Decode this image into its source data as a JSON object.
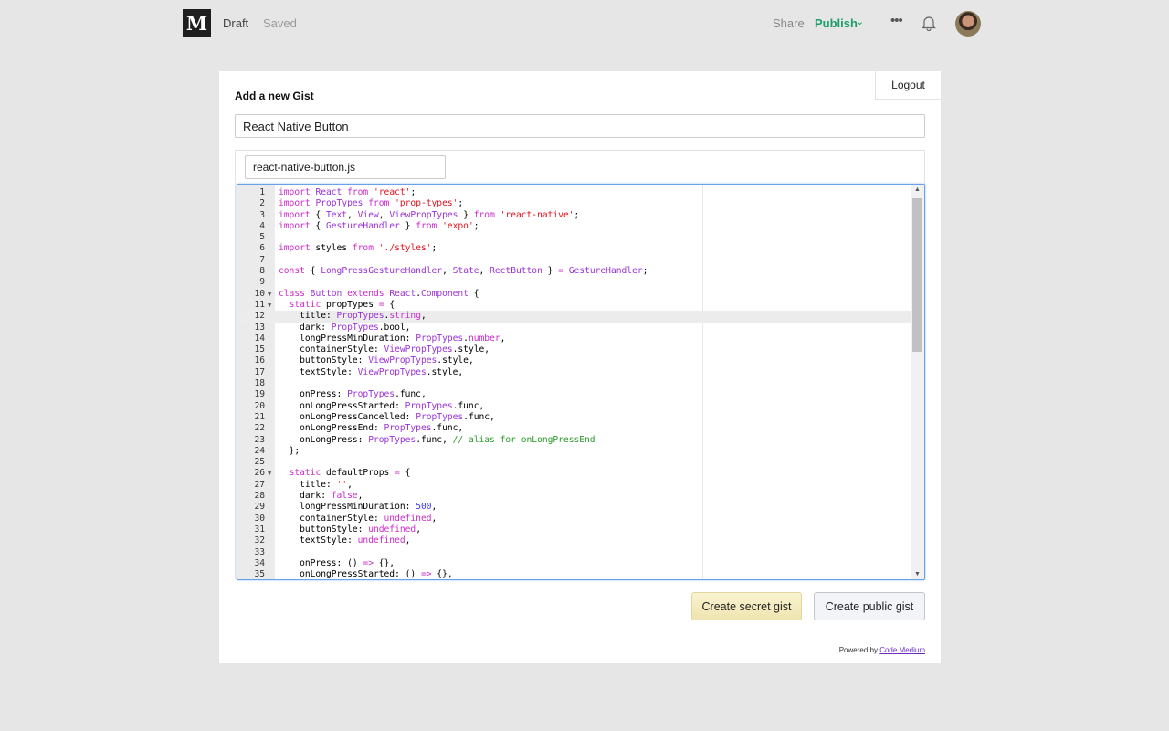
{
  "header": {
    "logo": "M",
    "draft": "Draft",
    "saved": "Saved",
    "share": "Share",
    "publish": "Publish",
    "accent": "#1e9e6a",
    "icons": [
      "chevron-down-icon",
      "more-icon",
      "bell-icon",
      "avatar"
    ]
  },
  "card": {
    "logout": "Logout",
    "title": "Add a new Gist",
    "description": "React Native Button",
    "filename": "react-native-button.js",
    "secret_button": "Create secret gist",
    "public_button": "Create public gist",
    "powered_by": "Powered by",
    "powered_link": "Code Medium"
  },
  "editor": {
    "active_line": 12,
    "folds": [
      10,
      11,
      26
    ],
    "lines": [
      [
        [
          "k",
          "import"
        ],
        [
          "p",
          " "
        ],
        [
          "t",
          "React"
        ],
        [
          "p",
          " "
        ],
        [
          "k",
          "from"
        ],
        [
          "p",
          " "
        ],
        [
          "s",
          "'react'"
        ],
        [
          "p",
          ";"
        ]
      ],
      [
        [
          "k",
          "import"
        ],
        [
          "p",
          " "
        ],
        [
          "t",
          "PropTypes"
        ],
        [
          "p",
          " "
        ],
        [
          "k",
          "from"
        ],
        [
          "p",
          " "
        ],
        [
          "s",
          "'prop-types'"
        ],
        [
          "p",
          ";"
        ]
      ],
      [
        [
          "k",
          "import"
        ],
        [
          "p",
          " { "
        ],
        [
          "t",
          "Text"
        ],
        [
          "p",
          ", "
        ],
        [
          "t",
          "View"
        ],
        [
          "p",
          ", "
        ],
        [
          "t",
          "ViewPropTypes"
        ],
        [
          "p",
          " } "
        ],
        [
          "k",
          "from"
        ],
        [
          "p",
          " "
        ],
        [
          "s",
          "'react-native'"
        ],
        [
          "p",
          ";"
        ]
      ],
      [
        [
          "k",
          "import"
        ],
        [
          "p",
          " { "
        ],
        [
          "t",
          "GestureHandler"
        ],
        [
          "p",
          " } "
        ],
        [
          "k",
          "from"
        ],
        [
          "p",
          " "
        ],
        [
          "s",
          "'expo'"
        ],
        [
          "p",
          ";"
        ]
      ],
      [],
      [
        [
          "k",
          "import"
        ],
        [
          "p",
          " styles "
        ],
        [
          "k",
          "from"
        ],
        [
          "p",
          " "
        ],
        [
          "s",
          "'./styles'"
        ],
        [
          "p",
          ";"
        ]
      ],
      [],
      [
        [
          "k",
          "const"
        ],
        [
          "p",
          " { "
        ],
        [
          "t",
          "LongPressGestureHandler"
        ],
        [
          "p",
          ", "
        ],
        [
          "t",
          "State"
        ],
        [
          "p",
          ", "
        ],
        [
          "t",
          "RectButton"
        ],
        [
          "p",
          " } "
        ],
        [
          "k",
          "="
        ],
        [
          "p",
          " "
        ],
        [
          "t",
          "GestureHandler"
        ],
        [
          "p",
          ";"
        ]
      ],
      [],
      [
        [
          "k",
          "class"
        ],
        [
          "p",
          " "
        ],
        [
          "t",
          "Button"
        ],
        [
          "p",
          " "
        ],
        [
          "k",
          "extends"
        ],
        [
          "p",
          " "
        ],
        [
          "t",
          "React"
        ],
        [
          "p",
          "."
        ],
        [
          "t",
          "Component"
        ],
        [
          "p",
          " {"
        ]
      ],
      [
        [
          "p",
          "  "
        ],
        [
          "k",
          "static"
        ],
        [
          "p",
          " propTypes "
        ],
        [
          "k",
          "="
        ],
        [
          "p",
          " {"
        ]
      ],
      [
        [
          "p",
          "    title: "
        ],
        [
          "t",
          "PropTypes"
        ],
        [
          "p",
          "."
        ],
        [
          "k",
          "string"
        ],
        [
          "p",
          ","
        ]
      ],
      [
        [
          "p",
          "    dark: "
        ],
        [
          "t",
          "PropTypes"
        ],
        [
          "p",
          ".bool,"
        ]
      ],
      [
        [
          "p",
          "    longPressMinDuration: "
        ],
        [
          "t",
          "PropTypes"
        ],
        [
          "p",
          "."
        ],
        [
          "k",
          "number"
        ],
        [
          "p",
          ","
        ]
      ],
      [
        [
          "p",
          "    containerStyle: "
        ],
        [
          "t",
          "ViewPropTypes"
        ],
        [
          "p",
          ".style,"
        ]
      ],
      [
        [
          "p",
          "    buttonStyle: "
        ],
        [
          "t",
          "ViewPropTypes"
        ],
        [
          "p",
          ".style,"
        ]
      ],
      [
        [
          "p",
          "    textStyle: "
        ],
        [
          "t",
          "ViewPropTypes"
        ],
        [
          "p",
          ".style,"
        ]
      ],
      [],
      [
        [
          "p",
          "    onPress: "
        ],
        [
          "t",
          "PropTypes"
        ],
        [
          "p",
          ".func,"
        ]
      ],
      [
        [
          "p",
          "    onLongPressStarted: "
        ],
        [
          "t",
          "PropTypes"
        ],
        [
          "p",
          ".func,"
        ]
      ],
      [
        [
          "p",
          "    onLongPressCancelled: "
        ],
        [
          "t",
          "PropTypes"
        ],
        [
          "p",
          ".func,"
        ]
      ],
      [
        [
          "p",
          "    onLongPressEnd: "
        ],
        [
          "t",
          "PropTypes"
        ],
        [
          "p",
          ".func,"
        ]
      ],
      [
        [
          "p",
          "    onLongPress: "
        ],
        [
          "t",
          "PropTypes"
        ],
        [
          "p",
          ".func, "
        ],
        [
          "c",
          "// alias for onLongPressEnd"
        ]
      ],
      [
        [
          "p",
          "  };"
        ]
      ],
      [],
      [
        [
          "p",
          "  "
        ],
        [
          "k",
          "static"
        ],
        [
          "p",
          " defaultProps "
        ],
        [
          "k",
          "="
        ],
        [
          "p",
          " {"
        ]
      ],
      [
        [
          "p",
          "    title: "
        ],
        [
          "s",
          "''"
        ],
        [
          "p",
          ","
        ]
      ],
      [
        [
          "p",
          "    dark: "
        ],
        [
          "k",
          "false"
        ],
        [
          "p",
          ","
        ]
      ],
      [
        [
          "p",
          "    longPressMinDuration: "
        ],
        [
          "n",
          "500"
        ],
        [
          "p",
          ","
        ]
      ],
      [
        [
          "p",
          "    containerStyle: "
        ],
        [
          "k",
          "undefined"
        ],
        [
          "p",
          ","
        ]
      ],
      [
        [
          "p",
          "    buttonStyle: "
        ],
        [
          "k",
          "undefined"
        ],
        [
          "p",
          ","
        ]
      ],
      [
        [
          "p",
          "    textStyle: "
        ],
        [
          "k",
          "undefined"
        ],
        [
          "p",
          ","
        ]
      ],
      [],
      [
        [
          "p",
          "    onPress: () "
        ],
        [
          "k",
          "=>"
        ],
        [
          "p",
          " {},"
        ]
      ],
      [
        [
          "p",
          "    onLongPressStarted: () "
        ],
        [
          "k",
          "=>"
        ],
        [
          "p",
          " {},"
        ]
      ]
    ]
  }
}
